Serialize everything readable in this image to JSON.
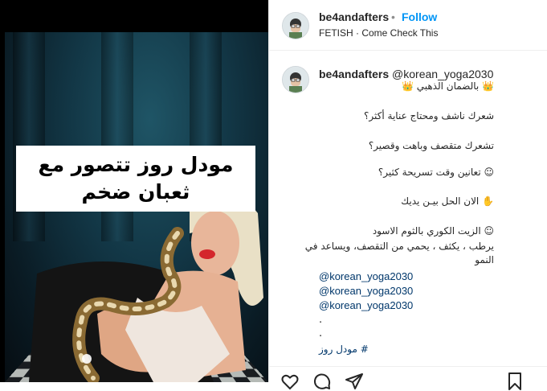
{
  "post": {
    "username": "be4andafters",
    "separator": "•",
    "follow_label": "Follow",
    "subtitle": "FETISH · Come Check This",
    "caption_overlay": "مودل روز تتصور مع ثعبان ضخم"
  },
  "comment": {
    "username": "be4andafters",
    "mention": "@korean_yoga2030",
    "lines": [
      "👑 بالضمان الذهبي 👑",
      "شعرك ناشف ومحتاج عناية أكثر؟",
      "تشعرك متقصف وباهت وقصير؟",
      "☺ تعانين وقت تسريحة كثير؟",
      "✋ الان الحل بيـن يديك",
      "☺ الزيت الكوري بالثوم الاسود",
      "يرطب ، يكثف ، يحمي من التقصف، ويساعد في",
      "النمو"
    ],
    "mentions": [
      "@korean_yoga2030",
      "@korean_yoga2030",
      "@korean_yoga2030"
    ],
    "dots": [
      ".",
      "."
    ],
    "hashtag": "# مودل روز"
  },
  "icons": [
    "heart-icon",
    "comment-icon",
    "share-icon",
    "bookmark-icon",
    "avatar-icon"
  ]
}
